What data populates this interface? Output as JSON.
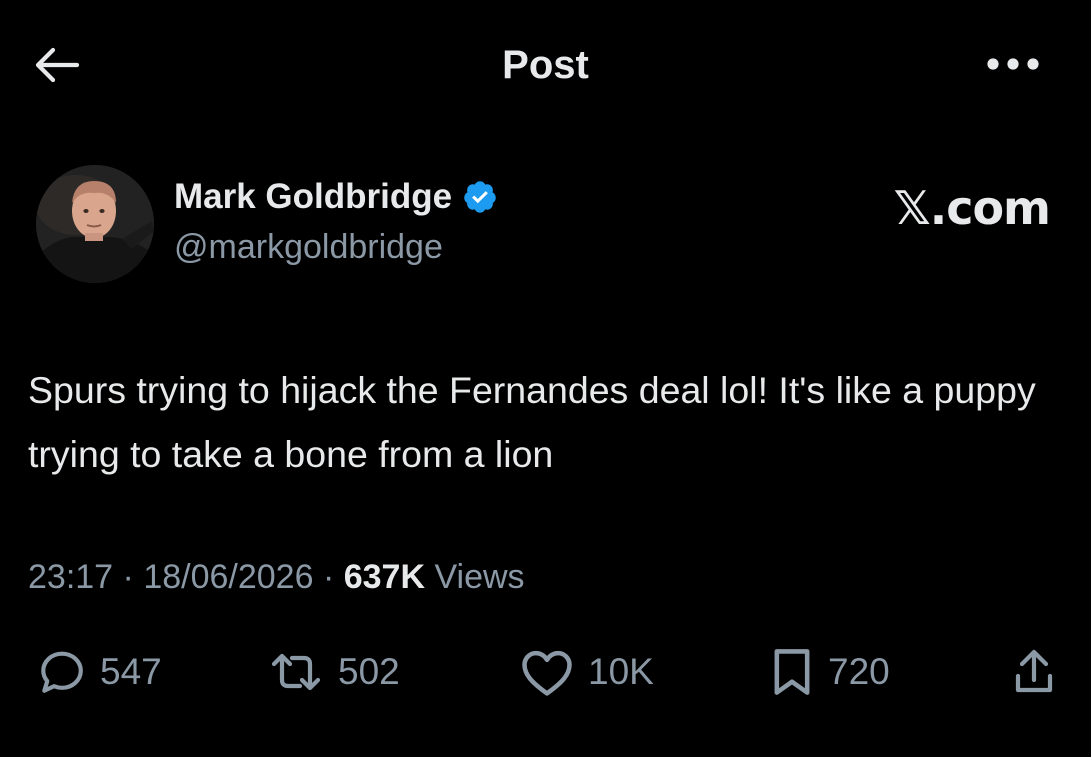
{
  "header": {
    "title": "Post",
    "back_icon": "arrow-left-icon",
    "more_icon": "more-horizontal-icon"
  },
  "author": {
    "display_name": "Mark Goldbridge",
    "handle": "@markgoldbridge",
    "verified": true,
    "verified_color": "#1d9bf0"
  },
  "watermark": "𝕏.com",
  "post": {
    "text": "Spurs trying to hijack the Fernandes deal lol! It's like a puppy trying to take a bone from a lion",
    "time": "23:17",
    "separator": "·",
    "date": "18/06/2026",
    "views_count": "637K",
    "views_label": "Views"
  },
  "actions": {
    "replies": "547",
    "reposts": "502",
    "likes": "10K",
    "bookmarks": "720"
  },
  "colors": {
    "background": "#000000",
    "text_primary": "#e7e9ea",
    "text_secondary": "#8b98a5",
    "accent": "#1d9bf0"
  }
}
